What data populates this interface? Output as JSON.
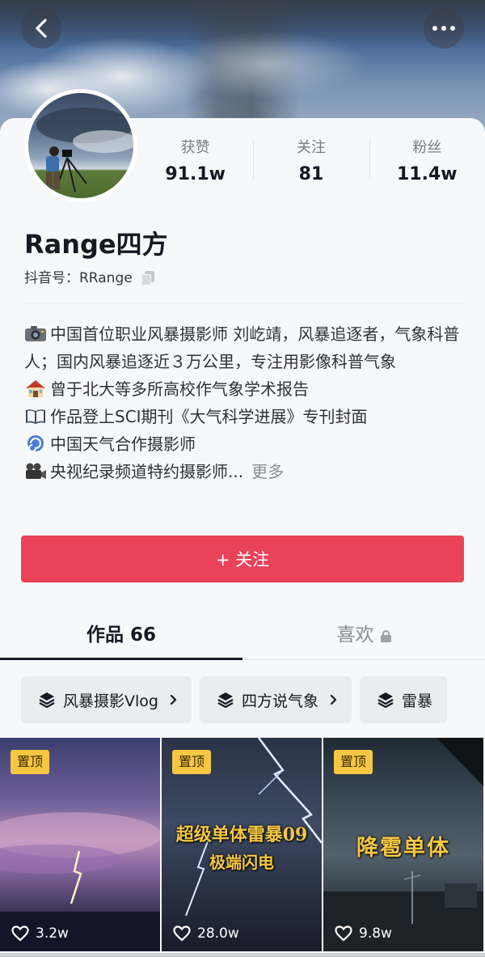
{
  "stats": [
    {
      "label": "获赞",
      "value": "91.1w"
    },
    {
      "label": "关注",
      "value": "81"
    },
    {
      "label": "粉丝",
      "value": "11.4w"
    }
  ],
  "profile": {
    "name": "Range四方",
    "douyin_id": "抖音号：RRange"
  },
  "bio": {
    "lines": [
      {
        "icon": "camera-emoji",
        "text": "中国首位职业风暴摄影师 刘屹靖，风暴追逐者，气象科普人；国内风暴追逐近３万公里，专注用影像科普气象"
      },
      {
        "icon": "house-emoji",
        "text": "曾于北大等多所高校作气象学术报告"
      },
      {
        "icon": "book-emoji",
        "text": "作品登上SCI期刊《大气科学进展》专刊封面"
      },
      {
        "icon": "cyclone-emoji",
        "text": "中国天气合作摄影师"
      },
      {
        "icon": "movie-camera-emoji",
        "text": "央视纪录频道特约摄影师..."
      }
    ],
    "more_label": "更多"
  },
  "follow_button": "+ 关注",
  "tabs": [
    {
      "label": "作品 66",
      "active": true
    },
    {
      "label": "喜欢",
      "active": false,
      "locked": true
    }
  ],
  "collections": [
    {
      "label": "风暴摄影Vlog"
    },
    {
      "label": "四方说气象"
    },
    {
      "label": "雷暴"
    }
  ],
  "videos": [
    {
      "pinned_label": "置顶",
      "caption": [],
      "likes": "3.2w"
    },
    {
      "pinned_label": "置顶",
      "caption": [
        "超级单体雷暴09",
        "极端闪电"
      ],
      "likes": "28.0w"
    },
    {
      "pinned_label": "置顶",
      "caption": [
        "降雹单体"
      ],
      "likes": "9.8w"
    }
  ],
  "colors": {
    "accent": "#ea4259",
    "pin_badge": "#f6c743",
    "caption": "#f3c843"
  }
}
